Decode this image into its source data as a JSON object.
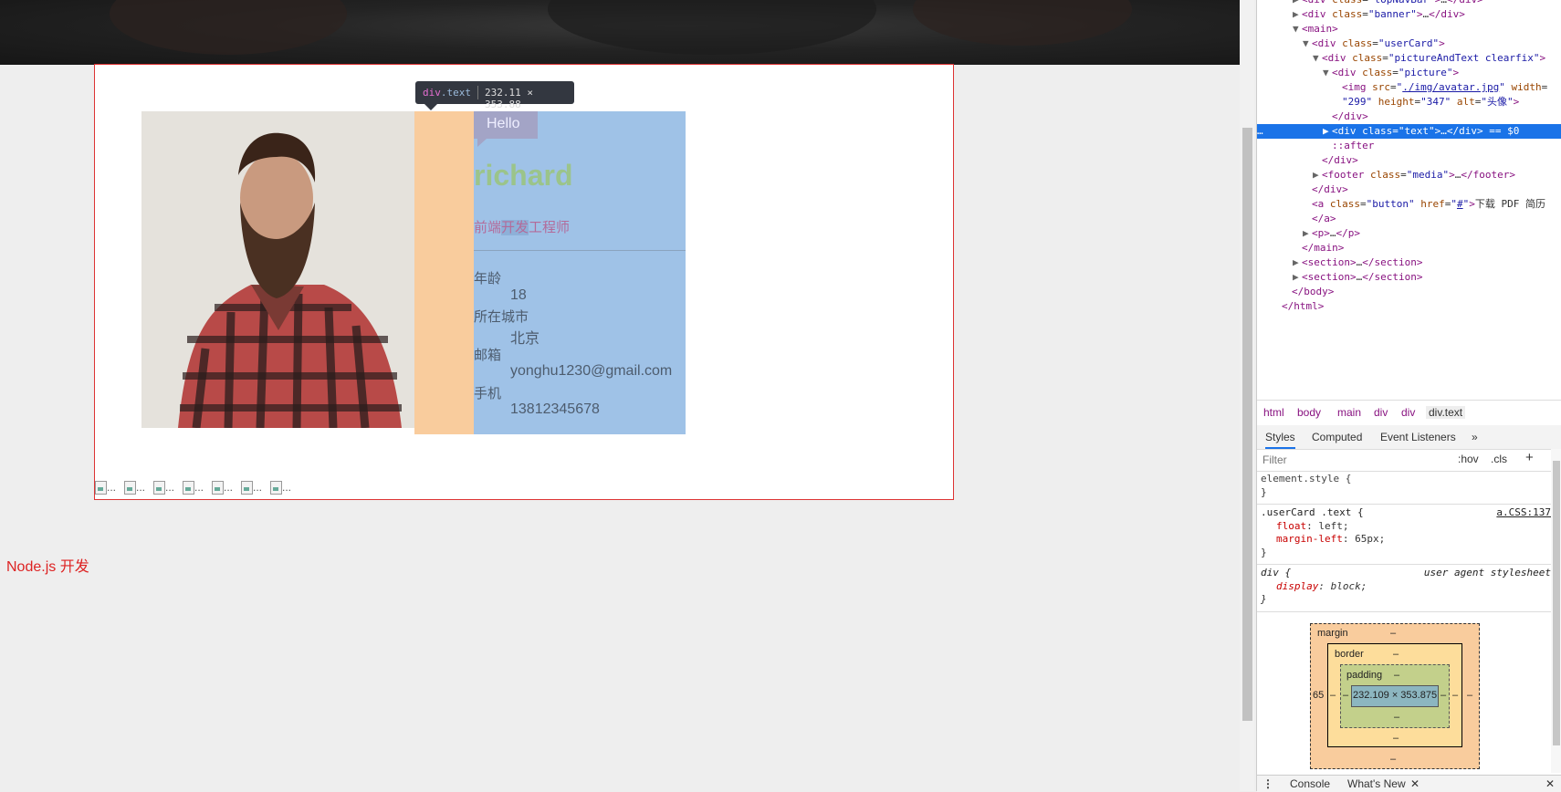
{
  "page": {
    "hello": "Hello",
    "name": "richard",
    "title_parts": [
      "前端",
      "开发",
      "工程师"
    ],
    "info": [
      {
        "label": "年龄",
        "value": "18"
      },
      {
        "label": "所在城市",
        "value": "北京"
      },
      {
        "label": "邮箱",
        "value": "yonghu1230@gmail.com"
      },
      {
        "label": "手机",
        "value": "13812345678"
      }
    ],
    "broken_images_label": "...",
    "broken_images_count": 7,
    "section_link": "Node.js 开发",
    "tooltip": {
      "tag": "div",
      "cls": ".text",
      "size": "232.11 × 353.88"
    }
  },
  "devtools": {
    "elements_lines": [
      {
        "indent": 3,
        "tw": "▶",
        "html": "<span class=\"tg\">&lt;div</span> <span class=\"at\">class</span>=<span class=\"av\">\"topNavBar\"</span><span class=\"tg\">&gt;</span>…<span class=\"tg\">&lt;/div&gt;</span>"
      },
      {
        "indent": 3,
        "tw": "▶",
        "html": "<span class=\"tg\">&lt;div</span> <span class=\"at\">class</span>=<span class=\"av\">\"banner\"</span><span class=\"tg\">&gt;</span>…<span class=\"tg\">&lt;/div&gt;</span>"
      },
      {
        "indent": 3,
        "tw": "▼",
        "html": "<span class=\"tg\">&lt;main&gt;</span>"
      },
      {
        "indent": 4,
        "tw": "▼",
        "html": "<span class=\"tg\">&lt;div</span> <span class=\"at\">class</span>=<span class=\"av\">\"userCard\"</span><span class=\"tg\">&gt;</span>"
      },
      {
        "indent": 5,
        "tw": "▼",
        "html": "<span class=\"tg\">&lt;div</span> <span class=\"at\">class</span>=<span class=\"av\">\"pictureAndText  clearfix\"</span><span class=\"tg\">&gt;</span>"
      },
      {
        "indent": 6,
        "tw": "▼",
        "html": "<span class=\"tg\">&lt;div</span> <span class=\"at\">class</span>=<span class=\"av\">\"picture\"</span><span class=\"tg\">&gt;</span>"
      },
      {
        "indent": 7,
        "tw": "",
        "html": "<span class=\"tg\">&lt;img</span> <span class=\"at\">src</span>=<span class=\"av\">\"<span class=\"lk\">./img/avatar.jpg</span>\"</span> <span class=\"at\">width</span>=<span class=\"av\"></span>"
      },
      {
        "indent": 7,
        "tw": "",
        "html": "<span class=\"av\">\"299\"</span> <span class=\"at\">height</span>=<span class=\"av\">\"347\"</span> <span class=\"at\">alt</span>=<span class=\"av\">\"头像\"</span><span class=\"tg\">&gt;</span>"
      },
      {
        "indent": 6,
        "tw": "",
        "html": "<span class=\"tg\">&lt;/div&gt;</span>"
      },
      {
        "indent": 6,
        "tw": "▶",
        "sel": true,
        "html": "<span class=\"tg\">&lt;div</span> <span class=\"at\">class</span>=<span class=\"av\">\"text\"</span><span class=\"tg\">&gt;</span>…<span class=\"tg\">&lt;/div&gt;</span> == $0"
      },
      {
        "indent": 6,
        "tw": "",
        "html": "<span class=\"ps\">::after</span>"
      },
      {
        "indent": 5,
        "tw": "",
        "html": "<span class=\"tg\">&lt;/div&gt;</span>"
      },
      {
        "indent": 5,
        "tw": "▶",
        "html": "<span class=\"tg\">&lt;footer</span> <span class=\"at\">class</span>=<span class=\"av\">\"media\"</span><span class=\"tg\">&gt;</span>…<span class=\"tg\">&lt;/footer&gt;</span>"
      },
      {
        "indent": 4,
        "tw": "",
        "html": "<span class=\"tg\">&lt;/div&gt;</span>"
      },
      {
        "indent": 4,
        "tw": "",
        "html": "<span class=\"tg\">&lt;a</span> <span class=\"at\">class</span>=<span class=\"av\">\"button\"</span> <span class=\"at\">href</span>=<span class=\"av\">\"<span class=\"lk\">#</span>\"</span><span class=\"tg\">&gt;</span>下载 PDF 简历"
      },
      {
        "indent": 4,
        "tw": "",
        "html": "<span class=\"tg\">&lt;/a&gt;</span>"
      },
      {
        "indent": 4,
        "tw": "▶",
        "html": "<span class=\"tg\">&lt;p&gt;</span>…<span class=\"tg\">&lt;/p&gt;</span>"
      },
      {
        "indent": 3,
        "tw": "",
        "html": "<span class=\"tg\">&lt;/main&gt;</span>"
      },
      {
        "indent": 3,
        "tw": "▶",
        "html": "<span class=\"tg\">&lt;section&gt;</span>…<span class=\"tg\">&lt;/section&gt;</span>"
      },
      {
        "indent": 3,
        "tw": "▶",
        "html": "<span class=\"tg\">&lt;section&gt;</span>…<span class=\"tg\">&lt;/section&gt;</span>"
      },
      {
        "indent": 2,
        "tw": "",
        "html": "<span class=\"tg\">&lt;/body&gt;</span>"
      },
      {
        "indent": 1,
        "tw": "",
        "html": "<span class=\"tg\">&lt;/html&gt;</span>"
      }
    ],
    "breadcrumbs": [
      "html",
      "body",
      "main",
      "div",
      "div",
      "div.text"
    ],
    "tabs": {
      "styles": "Styles",
      "computed": "Computed",
      "listeners": "Event Listeners",
      "more": "»"
    },
    "filter_placeholder": "Filter",
    "hov": ":hov",
    "cls": ".cls",
    "plus": "+",
    "element_style": "element.style {",
    "close_brace": "}",
    "rule1": {
      "selector": ".userCard .text {",
      "source": "a.CSS:137",
      "p1n": "float",
      "p1v": "left;",
      "p2n": "margin-left",
      "p2v": "65px;"
    },
    "rule2": {
      "selector": "div {",
      "source": "user agent stylesheet",
      "p1n": "display",
      "p1v": "block;"
    },
    "boxmodel": {
      "margin": "margin",
      "border": "border",
      "padding": "padding",
      "dash": "–",
      "left_margin": "65",
      "content": "232.109 × 353.875"
    },
    "drawer": {
      "console": "Console",
      "whatsnew": "What's New"
    }
  }
}
